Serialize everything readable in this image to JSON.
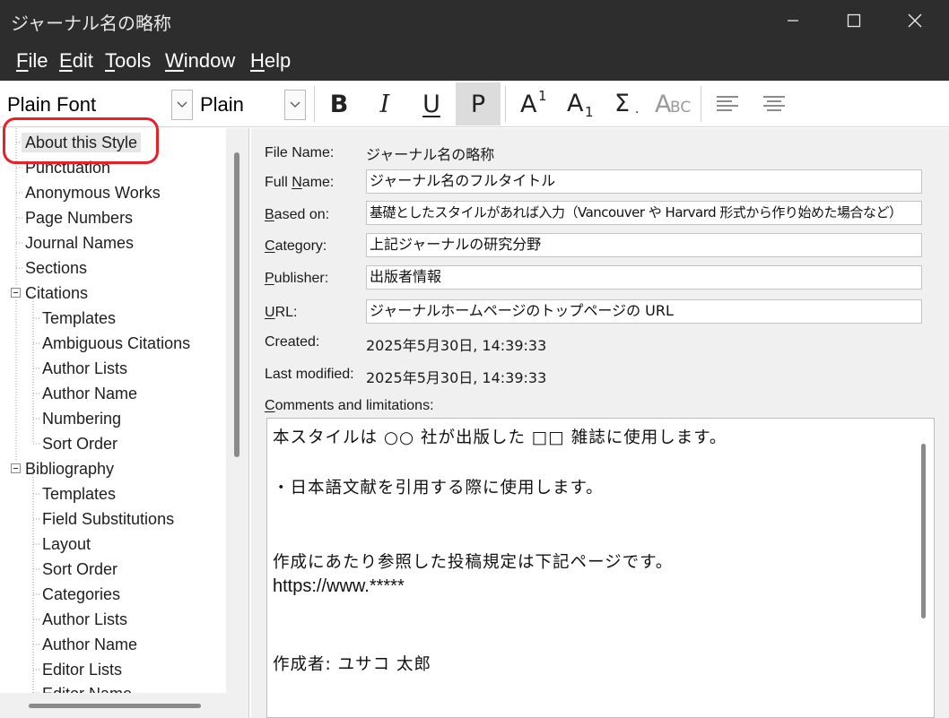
{
  "window": {
    "title": "ジャーナル名の略称"
  },
  "menu": {
    "items": [
      {
        "label_ul": "F",
        "label_rest": "ile"
      },
      {
        "label_ul": "E",
        "label_rest": "dit"
      },
      {
        "label_ul": "T",
        "label_rest": "ools"
      },
      {
        "label_ul": "W",
        "label_rest": "indow"
      },
      {
        "label_ul": "H",
        "label_rest": "elp"
      }
    ]
  },
  "toolbar": {
    "font_name": "Plain Font",
    "font_size": "Plain Size",
    "bold": "B",
    "italic": "I",
    "underline": "U",
    "plain": "P",
    "superscript_base": "A",
    "superscript_mark": "1",
    "subscript_base": "A",
    "subscript_mark": "1",
    "symbol": "Σ",
    "small_caps_big": "A",
    "small_caps_small": "BC"
  },
  "tree": {
    "items": [
      {
        "label": "About this Style"
      },
      {
        "label": "Punctuation"
      },
      {
        "label": "Anonymous Works"
      },
      {
        "label": "Page Numbers"
      },
      {
        "label": "Journal Names"
      },
      {
        "label": "Sections"
      },
      {
        "label": "Citations"
      },
      {
        "label": "Templates"
      },
      {
        "label": "Ambiguous Citations"
      },
      {
        "label": "Author Lists"
      },
      {
        "label": "Author Name"
      },
      {
        "label": "Numbering"
      },
      {
        "label": "Sort Order"
      },
      {
        "label": "Bibliography"
      },
      {
        "label": "Templates"
      },
      {
        "label": "Field Substitutions"
      },
      {
        "label": "Layout"
      },
      {
        "label": "Sort Order"
      },
      {
        "label": "Categories"
      },
      {
        "label": "Author Lists"
      },
      {
        "label": "Author Name"
      },
      {
        "label": "Editor Lists"
      },
      {
        "label": "Editor Name"
      }
    ]
  },
  "form": {
    "file_name_label": "File Name:",
    "file_name_value": "ジャーナル名の略称",
    "full_name_label_a": "Full ",
    "full_name_label_ul": "N",
    "full_name_label_b": "ame:",
    "full_name_value": "ジャーナル名のフルタイトル",
    "based_on_label_ul": "B",
    "based_on_label_rest": "ased on:",
    "based_on_value": "基礎としたスタイルがあれば入力（Vancouver や Harvard 形式から作り始めた場合など）",
    "category_label_ul": "C",
    "category_label_rest": "ategory:",
    "category_value": "上記ジャーナルの研究分野",
    "publisher_label_ul": "P",
    "publisher_label_rest": "ublisher:",
    "publisher_value": "出版者情報",
    "url_label_ul": "U",
    "url_label_rest": "RL:",
    "url_value": "ジャーナルホームページのトップページの URL",
    "created_label": "Created:",
    "created_value": "2025年5月30日, 14:39:33",
    "modified_label": "Last modified:",
    "modified_value": "2025年5月30日, 14:39:33",
    "comments_label_ul": "C",
    "comments_label_rest": "omments and limitations:",
    "comments": {
      "line1": "本スタイルは ○○ 社が出版した □□ 雑誌に使用します。",
      "line2": "・日本語文献を引用する際に使用します。",
      "line3": "作成にあたり参照した投稿規定は下記ページです。",
      "line4": "https://www.*****",
      "line5": "作成者:  ユサコ  太郎"
    }
  }
}
